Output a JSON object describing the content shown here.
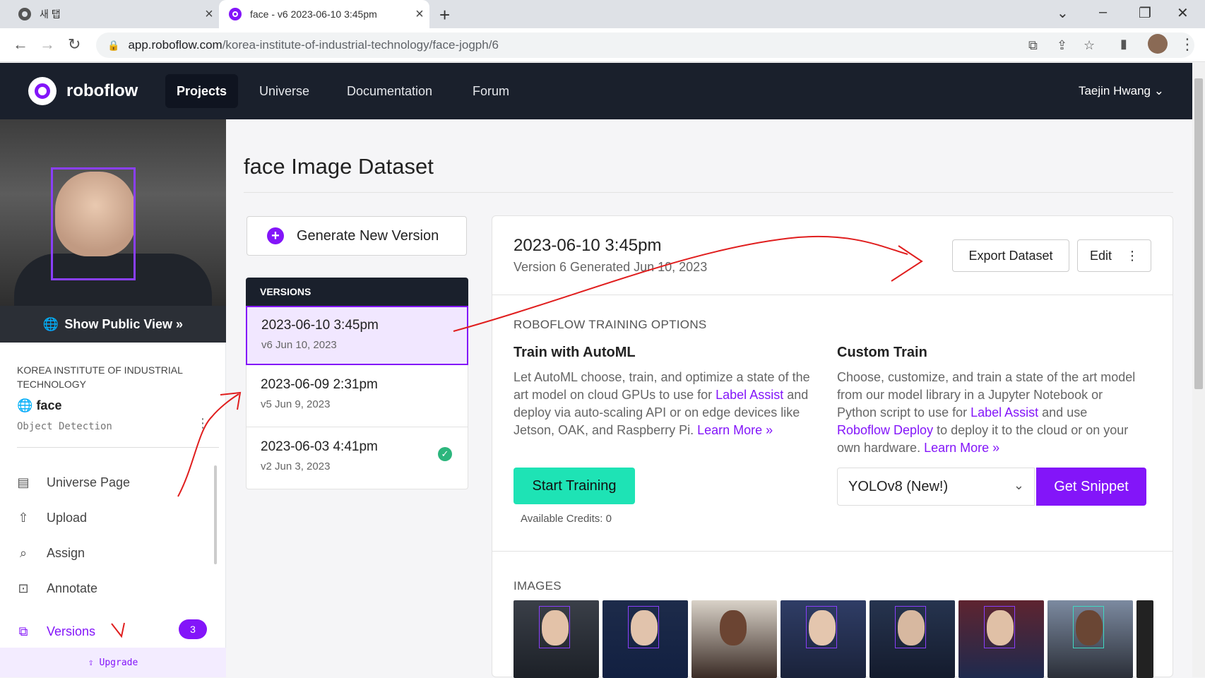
{
  "browser": {
    "tabs": [
      {
        "title": "새 탭"
      },
      {
        "title": "face - v6 2023-06-10 3:45pm"
      }
    ],
    "url_host": "app.roboflow.com",
    "url_path": "/korea-institute-of-industrial-technology/face-jogph/6"
  },
  "header": {
    "brand": "roboflow",
    "nav": [
      "Projects",
      "Universe",
      "Documentation",
      "Forum"
    ],
    "user": "Taejin Hwang"
  },
  "sidebar": {
    "public_view": "Show Public View »",
    "org": "KOREA INSTITUTE OF INDUSTRIAL TECHNOLOGY",
    "project": "face",
    "project_type": "Object Detection",
    "items": [
      {
        "label": "Universe Page",
        "icon": "book-icon"
      },
      {
        "label": "Upload",
        "icon": "upload-icon"
      },
      {
        "label": "Assign",
        "icon": "search-icon"
      },
      {
        "label": "Annotate",
        "icon": "annotate-icon"
      },
      {
        "label": "Versions",
        "icon": "folders-icon"
      }
    ],
    "versions_count": "3",
    "upgrade": "Upgrade"
  },
  "main": {
    "title": "face Image Dataset",
    "generate_button": "Generate New Version",
    "versions_header": "VERSIONS",
    "versions": [
      {
        "title": "2023-06-10 3:45pm",
        "sub": "v6 Jun 10, 2023"
      },
      {
        "title": "2023-06-09 2:31pm",
        "sub": "v5 Jun 9, 2023"
      },
      {
        "title": "2023-06-03 4:41pm",
        "sub": "v2 Jun 3, 2023"
      }
    ],
    "panel": {
      "title": "2023-06-10 3:45pm",
      "subtitle": "Version 6 Generated Jun 10, 2023",
      "export_button": "Export Dataset",
      "edit_button": "Edit",
      "section_label": "ROBOFLOW TRAINING OPTIONS",
      "automl_title": "Train with AutoML",
      "automl_text_1": "Let AutoML choose, train, and optimize a state of the art model on cloud GPUs to use for ",
      "automl_link_1": "Label Assist",
      "automl_text_2": " and deploy via auto-scaling API or on edge devices like Jetson, OAK, and Raspberry Pi. ",
      "automl_link_2": "Learn More »",
      "start_training": "Start Training",
      "credits": "Available Credits: 0",
      "custom_title": "Custom Train",
      "custom_text_1": "Choose, customize, and train a state of the art model from our model library in a Jupyter Notebook or Python script to use for ",
      "custom_link_1": "Label Assist",
      "custom_text_2": " and use ",
      "custom_link_2": "Roboflow Deploy",
      "custom_text_3": " to deploy it to the cloud or on your own hardware. ",
      "custom_link_3": "Learn More »",
      "model_select": "YOLOv8 (New!)",
      "get_snippet": "Get Snippet",
      "images_label": "IMAGES"
    }
  },
  "colors": {
    "accent": "#8315f9",
    "header_bg": "#1a202c",
    "train_btn": "#1ee3b5",
    "annotation_ink": "#e01e1e"
  }
}
